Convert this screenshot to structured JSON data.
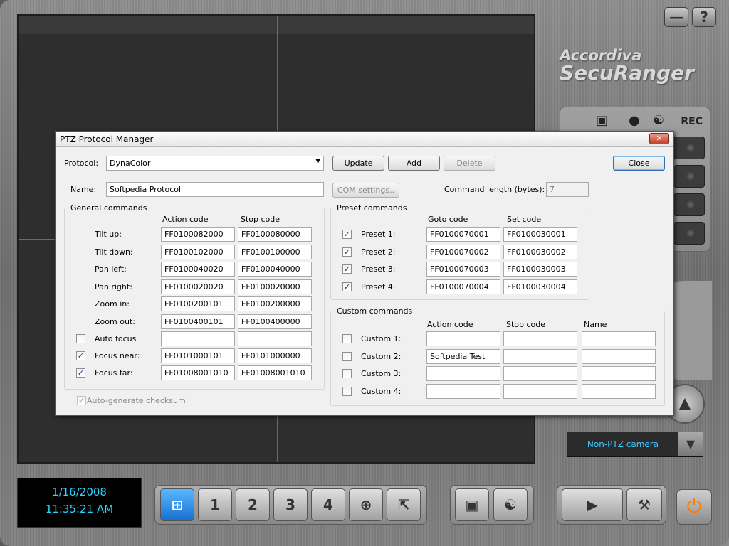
{
  "window_buttons": {
    "minimize": "—",
    "help": "?"
  },
  "brand": {
    "line1": "Accordiva",
    "line2": "SecuRanger"
  },
  "side_panel": {
    "rec_label": "REC"
  },
  "camera_select": {
    "value": "Non-PTZ camera"
  },
  "clock": {
    "date": "1/16/2008",
    "time": "11:35:21 AM"
  },
  "toolbar": {
    "views": [
      "",
      "1",
      "2",
      "3",
      "4",
      "",
      ""
    ]
  },
  "dialog": {
    "title": "PTZ Protocol Manager",
    "protocol_label": "Protocol:",
    "protocol_value": "DynaColor",
    "buttons": {
      "update": "Update",
      "add": "Add",
      "delete": "Delete",
      "close": "Close",
      "com_settings": "COM settings.."
    },
    "name_label": "Name:",
    "name_value": "Softpedia Protocol",
    "command_length_label": "Command length (bytes):",
    "command_length_value": "7",
    "general": {
      "title": "General commands",
      "col_action": "Action code",
      "col_stop": "Stop code",
      "rows": [
        {
          "label": "Tilt up:",
          "action": "FF0100082000",
          "stop": "FF0100080000"
        },
        {
          "label": "Tilt down:",
          "action": "FF0100102000",
          "stop": "FF0100100000"
        },
        {
          "label": "Pan left:",
          "action": "FF0100040020",
          "stop": "FF0100040000"
        },
        {
          "label": "Pan right:",
          "action": "FF0100020020",
          "stop": "FF0100020000"
        },
        {
          "label": "Zoom in:",
          "action": "FF0100200101",
          "stop": "FF0100200000"
        },
        {
          "label": "Zoom out:",
          "action": "FF0100400101",
          "stop": "FF0100400000"
        }
      ],
      "check_rows": [
        {
          "label": "Auto focus",
          "checked": false,
          "action": "",
          "stop": ""
        },
        {
          "label": "Focus near:",
          "checked": true,
          "action": "FF0101000101",
          "stop": "FF0101000000"
        },
        {
          "label": "Focus far:",
          "checked": true,
          "action": "FF01008001010",
          "stop": "FF01008001010"
        }
      ]
    },
    "auto_checksum_label": "Auto-generate checksum",
    "preset": {
      "title": "Preset commands",
      "col_goto": "Goto code",
      "col_set": "Set code",
      "rows": [
        {
          "label": "Preset 1:",
          "goto": "FF0100070001",
          "set": "FF0100030001"
        },
        {
          "label": "Preset 2:",
          "goto": "FF0100070002",
          "set": "FF0100030002"
        },
        {
          "label": "Preset 3:",
          "goto": "FF0100070003",
          "set": "FF0100030003"
        },
        {
          "label": "Preset 4:",
          "goto": "FF0100070004",
          "set": "FF0100030004"
        }
      ]
    },
    "custom": {
      "title": "Custom commands",
      "col_action": "Action code",
      "col_stop": "Stop code",
      "col_name": "Name",
      "rows": [
        {
          "label": "Custom 1:",
          "action": "",
          "stop": "",
          "name": ""
        },
        {
          "label": "Custom 2:",
          "action": "Softpedia Test",
          "stop": "",
          "name": ""
        },
        {
          "label": "Custom 3:",
          "action": "",
          "stop": "",
          "name": ""
        },
        {
          "label": "Custom 4:",
          "action": "",
          "stop": "",
          "name": ""
        }
      ]
    }
  }
}
